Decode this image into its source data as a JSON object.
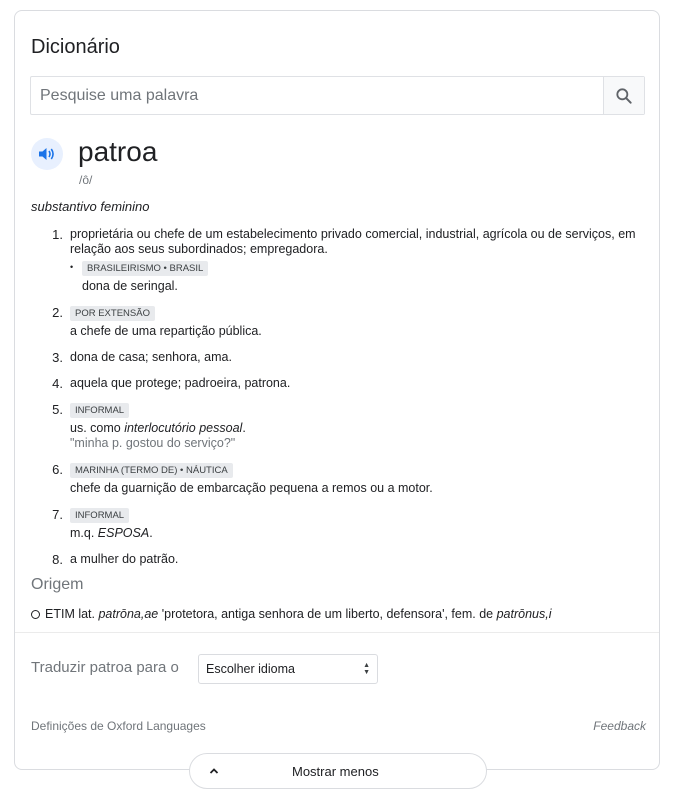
{
  "header": {
    "title": "Dicionário"
  },
  "search": {
    "placeholder": "Pesquise uma palavra",
    "value": ""
  },
  "entry": {
    "word": "patroa",
    "phonetic": "/ô/",
    "part_of_speech": "substantivo feminino",
    "definitions": [
      {
        "num": "1.",
        "text": "proprietária ou chefe de um estabelecimento privado comercial, industrial, agrícola ou de serviços, em relação aos seus subordinados; empregadora.",
        "sub": {
          "tag": "BRASILEIRISMO • BRASIL",
          "text": "dona de seringal."
        }
      },
      {
        "num": "2.",
        "tag": "POR EXTENSÃO",
        "text": "a chefe de uma repartição pública."
      },
      {
        "num": "3.",
        "text": "dona de casa; senhora, ama."
      },
      {
        "num": "4.",
        "text": "aquela que protege; padroeira, patrona."
      },
      {
        "num": "5.",
        "tag": "INFORMAL",
        "text_prefix": "us. como ",
        "text_em": "interlocutório pessoal",
        "text_suffix": ".",
        "example": "\"minha p. gostou do serviço?\""
      },
      {
        "num": "6.",
        "tag": "MARINHA (TERMO DE) • NÁUTICA",
        "text": "chefe da guarnição de embarcação pequena a remos ou a motor."
      },
      {
        "num": "7.",
        "tag": "INFORMAL",
        "text_prefix": "m.q. ",
        "text_em": "ESPOSA",
        "text_suffix": "."
      },
      {
        "num": "8.",
        "text": "a mulher do patrão."
      }
    ]
  },
  "origin": {
    "heading": "Origem",
    "prefix": "ETIM lat. ",
    "latin": "patrōna,ae",
    "middle": " 'protetora, antiga senhora de um liberto, defensora', fem. de ",
    "latin2": "patrōnus,i"
  },
  "translate": {
    "label": "Traduzir patroa para o",
    "select_value": "Escolher idioma"
  },
  "footer": {
    "source": "Definições de Oxford Languages",
    "feedback": "Feedback"
  },
  "show_less": {
    "label": "Mostrar menos"
  },
  "colors": {
    "accent": "#1a73e8",
    "speaker_bg": "#e8f0fe",
    "tag_bg": "#e8eaed",
    "muted": "#70757a"
  },
  "icons": {
    "search": "search-icon",
    "speaker": "speaker-icon",
    "origin": "circle-icon",
    "select": "up-down-arrows-icon",
    "collapse": "chevron-up-icon"
  }
}
